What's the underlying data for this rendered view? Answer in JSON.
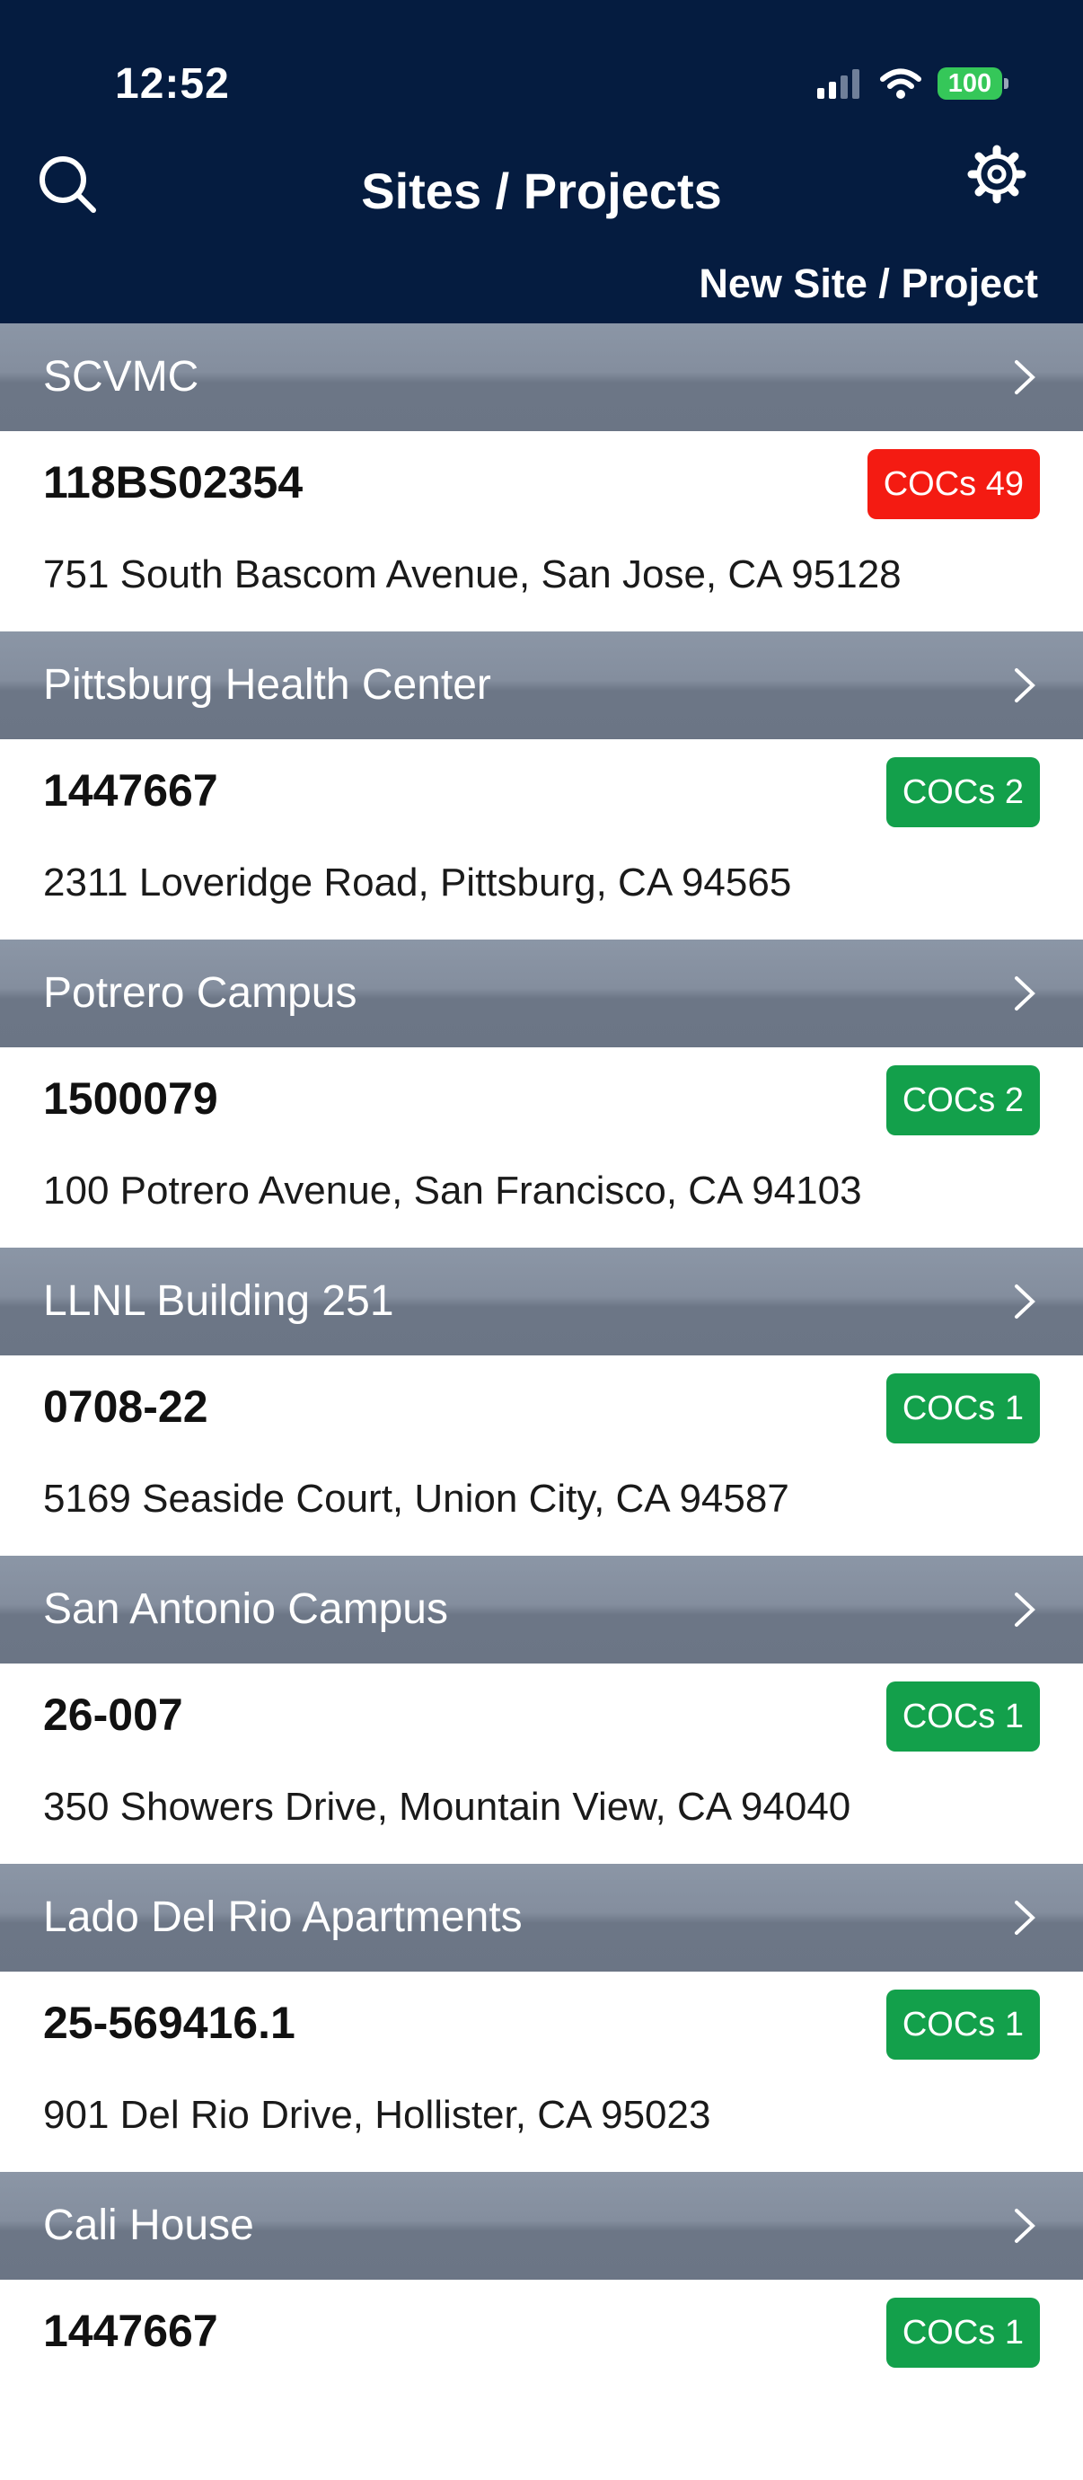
{
  "status_bar": {
    "time": "12:52",
    "battery": "100"
  },
  "header": {
    "title": "Sites / Projects",
    "new_button": "New Site / Project",
    "search_icon": "search-icon",
    "settings_icon": "gear-icon"
  },
  "colors": {
    "header_bg": "#051c40",
    "badge_red": "#f41b12",
    "badge_green": "#13a04b",
    "section_bg": "#7b8595"
  },
  "sites": [
    {
      "name": "SCVMC",
      "id": "118BS02354",
      "coc": "COCs 49",
      "status": "red",
      "address": "751 South Bascom Avenue, San Jose, CA 95128"
    },
    {
      "name": "Pittsburg Health Center",
      "id": "1447667",
      "coc": "COCs 2",
      "status": "green",
      "address": "2311 Loveridge Road, Pittsburg, CA 94565"
    },
    {
      "name": "Potrero Campus",
      "id": "1500079",
      "coc": "COCs 2",
      "status": "green",
      "address": "100 Potrero Avenue, San Francisco, CA 94103"
    },
    {
      "name": "LLNL Building 251",
      "id": "0708-22",
      "coc": "COCs 1",
      "status": "green",
      "address": "5169 Seaside Court, Union City, CA 94587"
    },
    {
      "name": "San Antonio Campus",
      "id": "26-007",
      "coc": "COCs 1",
      "status": "green",
      "address": "350 Showers Drive, Mountain View, CA 94040"
    },
    {
      "name": "Lado Del Rio Apartments",
      "id": "25-569416.1",
      "coc": "COCs 1",
      "status": "green",
      "address": "901 Del Rio Drive, Hollister, CA 95023"
    },
    {
      "name": "Cali House",
      "id": "1447667",
      "coc": "COCs 1",
      "status": "green",
      "address": ""
    }
  ]
}
